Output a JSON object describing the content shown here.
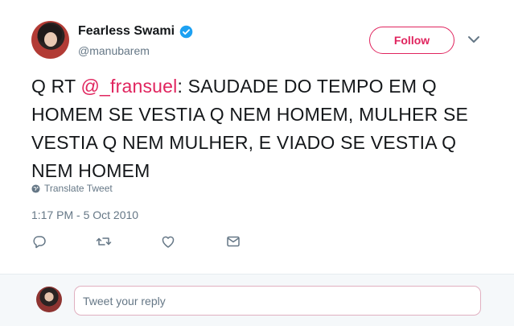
{
  "tweet": {
    "author_name": "Fearless Swami",
    "author_handle": "@manubarem",
    "follow_label": "Follow",
    "text_prefix": "Q RT ",
    "mention": "@_fransuel",
    "text_rest": ": SAUDADE DO TEMPO EM Q HOMEM SE VESTIA Q NEM HOMEM, MULHER SE VESTIA Q NEM MULHER, E VIADO SE VESTIA Q NEM HOMEM",
    "translate_label": "Translate Tweet",
    "timestamp": "1:17 PM - 5 Oct 2010"
  },
  "reply": {
    "placeholder": "Tweet your reply"
  },
  "colors": {
    "accent": "#e0245e",
    "verified": "#1da1f2",
    "muted": "#657786"
  },
  "icons": {
    "verified": "verified-badge-icon",
    "caret": "chevron-down-icon",
    "translate": "globe-icon",
    "reply": "reply-icon",
    "retweet": "retweet-icon",
    "like": "heart-icon",
    "message": "envelope-icon"
  }
}
